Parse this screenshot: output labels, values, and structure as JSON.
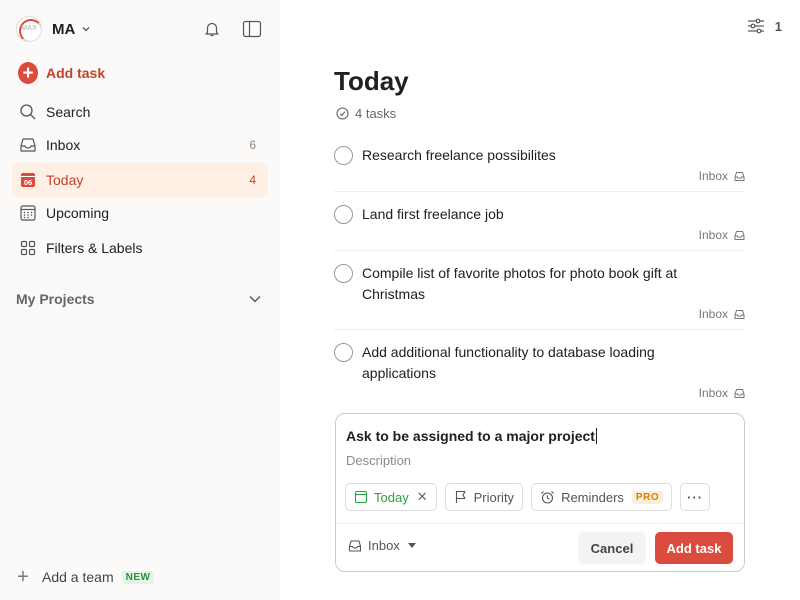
{
  "sidebar": {
    "avatar_text": "MAX",
    "user_name": "MA",
    "add_task_label": "Add task",
    "items": [
      {
        "label": "Search",
        "count": ""
      },
      {
        "label": "Inbox",
        "count": "6"
      },
      {
        "label": "Today",
        "count": "4",
        "icon_text": "06"
      },
      {
        "label": "Upcoming",
        "count": ""
      },
      {
        "label": "Filters & Labels",
        "count": ""
      }
    ],
    "projects_label": "My Projects",
    "add_team_label": "Add a team",
    "new_badge": "NEW"
  },
  "main": {
    "view_count": "1",
    "title": "Today",
    "task_count": "4 tasks",
    "tasks": [
      {
        "title": "Research freelance possibilites",
        "project": "Inbox"
      },
      {
        "title": "Land first freelance job",
        "project": "Inbox"
      },
      {
        "title": "Compile list of favorite photos for photo book gift at Christmas",
        "project": "Inbox"
      },
      {
        "title": "Add additional functionality to database loading applications",
        "project": "Inbox"
      }
    ]
  },
  "editor": {
    "task_name": "Ask to be assigned to a major project",
    "description_placeholder": "Description",
    "date_chip": "Today",
    "priority_chip": "Priority",
    "reminders_chip": "Reminders",
    "pro_badge": "PRO",
    "more_label": "···",
    "project": "Inbox",
    "cancel_label": "Cancel",
    "add_label": "Add task"
  },
  "colors": {
    "accent": "#dc4c3e",
    "active_bg": "#ffefe5",
    "sidebar_bg": "#fcfaf8",
    "today_green": "#25a244"
  }
}
